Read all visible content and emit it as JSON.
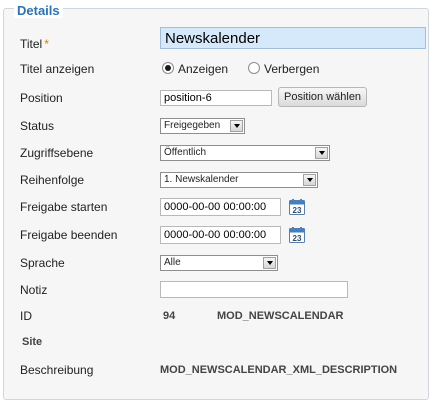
{
  "section": {
    "legend": "Details"
  },
  "fields": {
    "titel": {
      "label": "Titel",
      "required_mark": "*",
      "value": "Newskalender"
    },
    "titel_anzeigen": {
      "label": "Titel anzeigen",
      "option_show": "Anzeigen",
      "option_hide": "Verbergen",
      "selected": "Anzeigen"
    },
    "position": {
      "label": "Position",
      "value": "position-6",
      "button": "Position wählen"
    },
    "status": {
      "label": "Status",
      "value": "Freigegeben"
    },
    "zugriffsebene": {
      "label": "Zugriffsebene",
      "value": "Öffentlich"
    },
    "reihenfolge": {
      "label": "Reihenfolge",
      "value": "1. Newskalender"
    },
    "freigabe_starten": {
      "label": "Freigabe starten",
      "value": "0000-00-00 00:00:00",
      "calendar_day": "23"
    },
    "freigabe_beenden": {
      "label": "Freigabe beenden",
      "value": "0000-00-00 00:00:00",
      "calendar_day": "23"
    },
    "sprache": {
      "label": "Sprache",
      "value": "Alle"
    },
    "notiz": {
      "label": "Notiz",
      "value": ""
    },
    "id": {
      "label": "ID",
      "value": "94",
      "module": "MOD_NEWSCALENDAR"
    },
    "site": {
      "label": "Site"
    },
    "beschreibung": {
      "label": "Beschreibung",
      "value": "MOD_NEWSCALENDAR_XML_DESCRIPTION"
    }
  },
  "colors": {
    "legend": "#2a73b8",
    "title_input_bg": "#d5e9fb",
    "required": "#e07b00"
  },
  "icons": {
    "calendar": "calendar-icon",
    "dropdown": "chevron-down-icon"
  }
}
